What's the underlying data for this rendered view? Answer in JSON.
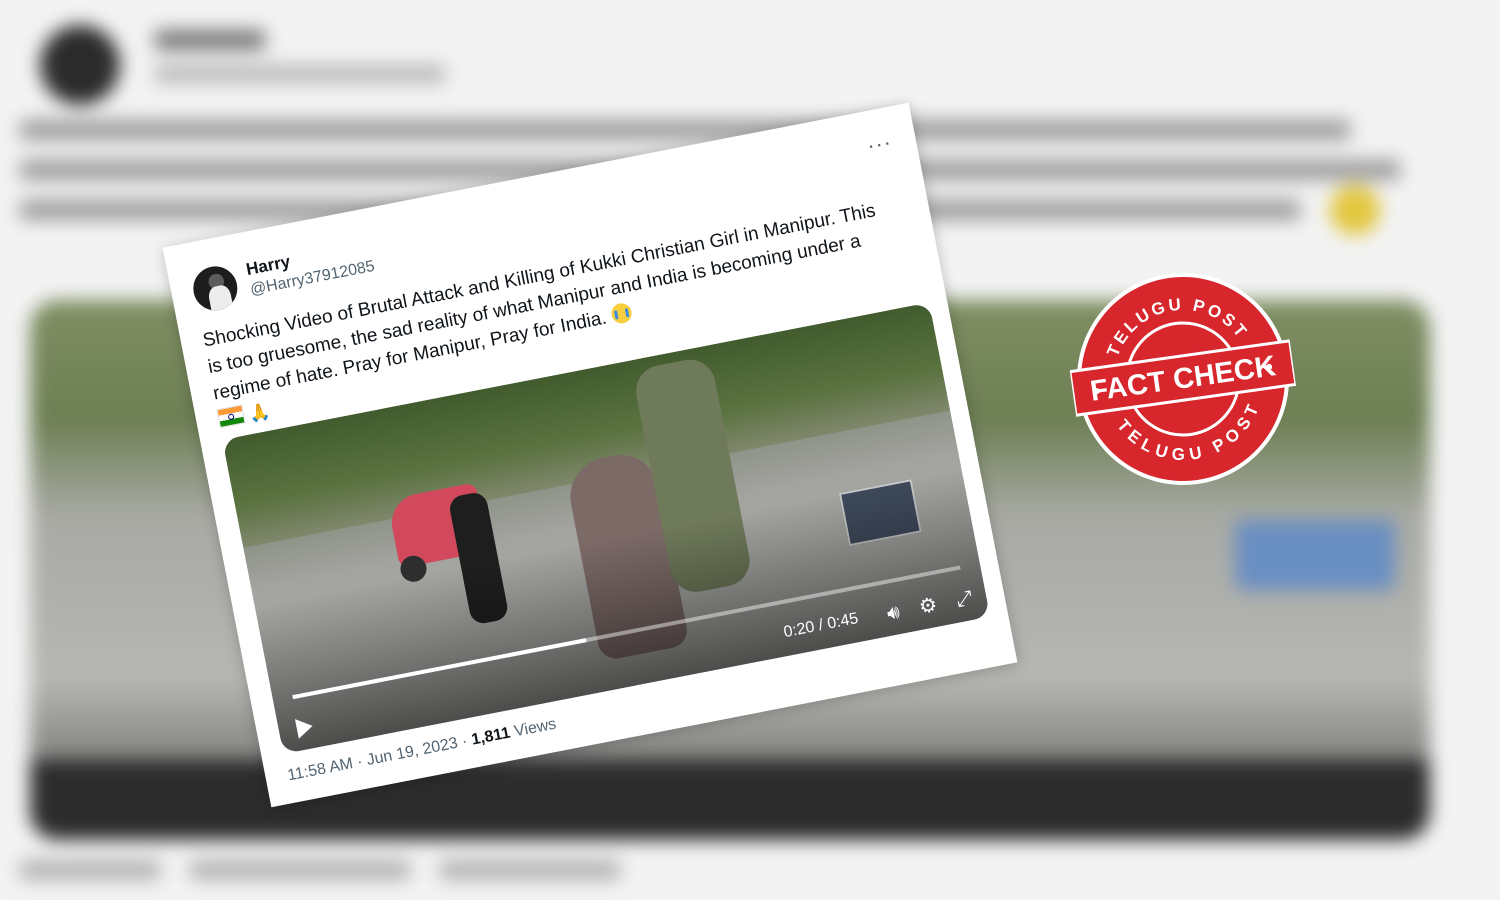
{
  "tweet": {
    "name": "Harry",
    "handle": "@Harry37912085",
    "more_icon": "ellipsis-icon",
    "text": "Shocking Video of Brutal Attack and Killing of Kukki Christian Girl in Manipur. This is too gruesome,  the sad reality of what Manipur and India is becoming under a regime of hate. Pray for Manipur, Pray for India.",
    "emojis": [
      "crying-face",
      "india-flag",
      "folded-hands"
    ],
    "video": {
      "time": "0:20 / 0:45",
      "progress": 0.44,
      "controls": [
        "play-icon",
        "volume-icon",
        "settings-icon",
        "fullscreen-icon"
      ]
    },
    "time_date": "11:58 AM · Jun 19, 2023 · ",
    "views_count": "1,811",
    "views_label": " Views"
  },
  "stamp": {
    "top_text": "TELUGU POST",
    "center_text": "FACT CHECK",
    "bottom_text": "TELUGU POST",
    "color": "#d7262c"
  }
}
